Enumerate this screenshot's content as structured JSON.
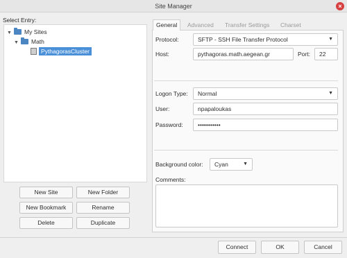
{
  "window": {
    "title": "Site Manager"
  },
  "tree": {
    "label": "Select Entry:",
    "items": [
      {
        "label": "My Sites",
        "icon": "folder-icon"
      },
      {
        "label": "Math",
        "icon": "folder-icon"
      },
      {
        "label": "PythagorasCluster",
        "icon": "server-icon",
        "selected": true
      }
    ]
  },
  "left_buttons": {
    "new_site": "New Site",
    "new_folder": "New Folder",
    "new_bookmark": "New Bookmark",
    "rename": "Rename",
    "delete": "Delete",
    "duplicate": "Duplicate"
  },
  "tabs": [
    {
      "label": "General",
      "active": true
    },
    {
      "label": "Advanced",
      "active": false
    },
    {
      "label": "Transfer Settings",
      "active": false
    },
    {
      "label": "Charset",
      "active": false
    }
  ],
  "general": {
    "protocol_label": "Protocol:",
    "protocol_value": "SFTP - SSH File Transfer Protocol",
    "host_label": "Host:",
    "host_value": "pythagoras.math.aegean.gr",
    "port_label": "Port:",
    "port_value": "22",
    "logon_type_label": "Logon Type:",
    "logon_type_value": "Normal",
    "user_label": "User:",
    "user_value": "npapaloukas",
    "password_label": "Password:",
    "password_value": "•••••••••••",
    "bg_color_label": "Background color:",
    "bg_color_value": "Cyan",
    "comments_label": "Comments:"
  },
  "footer": {
    "connect": "Connect",
    "ok": "OK",
    "cancel": "Cancel"
  },
  "colors": {
    "selection": "#4a90d9",
    "folder": "#4b86c2",
    "close": "#d74040"
  }
}
